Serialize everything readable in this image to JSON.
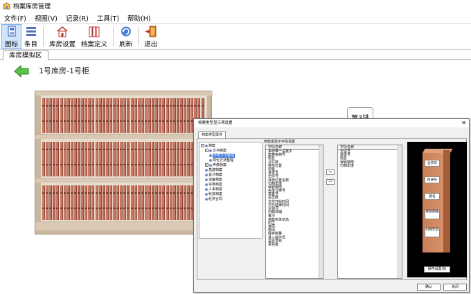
{
  "window": {
    "title": "档案库房管理"
  },
  "menu": [
    "文件(F)",
    "视图(V)",
    "记录(R)",
    "工具(T)",
    "帮助(H)"
  ],
  "toolbar": {
    "icon_view": "图标",
    "list_view": "条目",
    "room_setup": "库房设置",
    "archive_def": "档案定义",
    "refresh": "刷新",
    "exit": "退出"
  },
  "tab": {
    "label": "库房模拟区"
  },
  "location": "1号库房-1号柜",
  "shelf_label": "第3排",
  "dialog": {
    "title": "档案类型显示项设置",
    "tab": "档案类型属性",
    "tree": [
      {
        "label": "档案",
        "level": 0,
        "expander": "-"
      },
      {
        "label": "文书档案",
        "level": 1,
        "expander": "-"
      },
      {
        "label": "传统方法整理",
        "level": 2,
        "selected": true
      },
      {
        "label": "简化方法整理",
        "level": 2
      },
      {
        "label": "声像档案",
        "level": 1,
        "expander": "+"
      },
      {
        "label": "基建档案",
        "level": 1
      },
      {
        "label": "会计档案",
        "level": 1
      },
      {
        "label": "设备档案",
        "level": 1
      },
      {
        "label": "实物档案",
        "level": 1
      },
      {
        "label": "人事档案",
        "level": 1
      },
      {
        "label": "科技档案",
        "level": 1
      },
      {
        "label": "经济合同",
        "level": 1
      }
    ],
    "section_label": "档案盒显示字段设置",
    "left_list": {
      "header": "字段名称",
      "items": [
        "系统唯一关键字",
        "案卷级档号",
        "题名",
        "总件数",
        "存放位置",
        "密级",
        "目录号",
        "全宗号",
        "存放位置名称",
        "归档年度",
        "保管期限",
        "实体分类号",
        "案卷号",
        "总页数",
        "文件开始时间",
        "文件结束时间",
        "主题词",
        "归档日期",
        "备注",
        "档案实体状态",
        "附注",
        "条码",
        "借出",
        "库存数量",
        "录入操作员",
        "是否发布",
        "责任者"
      ]
    },
    "right_list": {
      "header": "字段名称",
      "items": [
        "全宗号",
        "目录号",
        "题名",
        "保管期限",
        "归档年度"
      ]
    },
    "preview_labels": [
      "全宗号",
      "目录号",
      "题名",
      "保管期限",
      "归档年度"
    ],
    "save_button": "保存设置(S)",
    "ok_button": "确认",
    "close_button": "关闭"
  }
}
